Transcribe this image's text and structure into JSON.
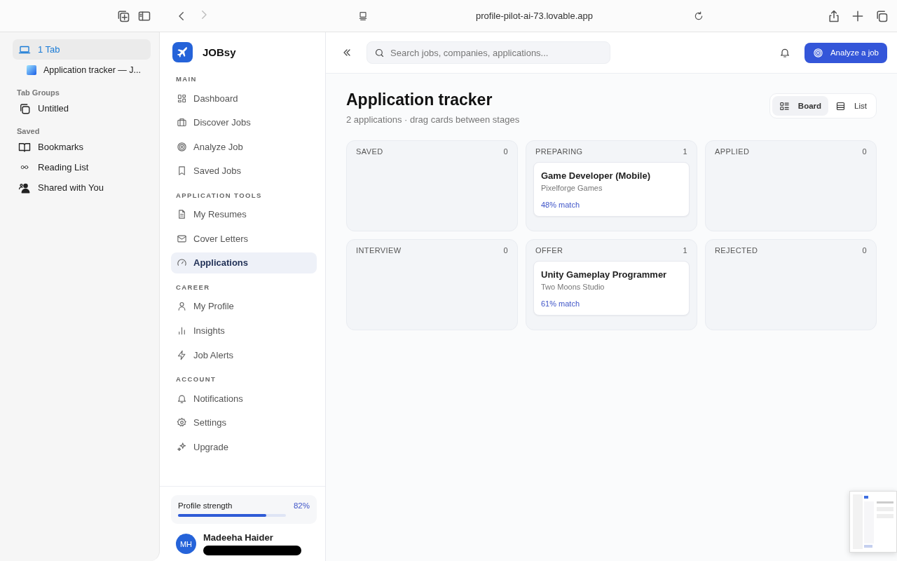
{
  "browser": {
    "url": "profile-pilot-ai-73.lovable.app",
    "sidebar": {
      "tab_count": {
        "label": "1 Tab",
        "selected": true
      },
      "tabs": [
        {
          "title": "Application tracker — J..."
        }
      ],
      "groups_heading": "Tab Groups",
      "groups": [
        {
          "label": "Untitled"
        }
      ],
      "saved_heading": "Saved",
      "saved": [
        {
          "label": "Bookmarks"
        },
        {
          "label": "Reading List"
        },
        {
          "label": "Shared with You"
        }
      ]
    }
  },
  "app": {
    "brand": "JOBsy",
    "nav": [
      {
        "heading": "MAIN",
        "items": [
          {
            "label": "Dashboard",
            "selected": false
          },
          {
            "label": "Discover Jobs",
            "selected": false
          },
          {
            "label": "Analyze Job",
            "selected": false
          },
          {
            "label": "Saved Jobs",
            "selected": false
          }
        ]
      },
      {
        "heading": "APPLICATION TOOLS",
        "items": [
          {
            "label": "My Resumes",
            "selected": false
          },
          {
            "label": "Cover Letters",
            "selected": false
          },
          {
            "label": "Applications",
            "selected": true
          }
        ]
      },
      {
        "heading": "CAREER",
        "items": [
          {
            "label": "My Profile",
            "selected": false
          },
          {
            "label": "Insights",
            "selected": false
          },
          {
            "label": "Job Alerts",
            "selected": false
          }
        ]
      },
      {
        "heading": "ACCOUNT",
        "items": [
          {
            "label": "Notifications",
            "selected": false
          },
          {
            "label": "Settings",
            "selected": false
          },
          {
            "label": "Upgrade",
            "selected": false
          }
        ]
      }
    ],
    "profile_strength": {
      "label": "Profile strength",
      "reading": "82%",
      "level": 0.82
    },
    "user": {
      "initials": "MH",
      "name": "Madeeha Haider",
      "email_redacted": true
    },
    "search": {
      "placeholder": "Search jobs, companies, applications..."
    },
    "primary_button": "Analyze a job",
    "page": {
      "title": "Application tracker",
      "subtitle": "2 applications · drag cards between stages",
      "views": [
        {
          "label": "Board",
          "selected": true
        },
        {
          "label": "List",
          "selected": false
        }
      ],
      "columns": [
        {
          "title": "SAVED",
          "count": "0"
        },
        {
          "title": "PREPARING",
          "count": "1",
          "cards": [
            {
              "title": "Game Developer (Mobile)",
              "company": "Pixelforge Games",
              "match": "48% match"
            }
          ]
        },
        {
          "title": "APPLIED",
          "count": "0"
        },
        {
          "title": "INTERVIEW",
          "count": "0"
        },
        {
          "title": "OFFER",
          "count": "1",
          "cards": [
            {
              "title": "Unity Gameplay Programmer",
              "company": "Two Moons Studio",
              "match": "61% match"
            }
          ]
        },
        {
          "title": "REJECTED",
          "count": "0"
        }
      ]
    }
  }
}
